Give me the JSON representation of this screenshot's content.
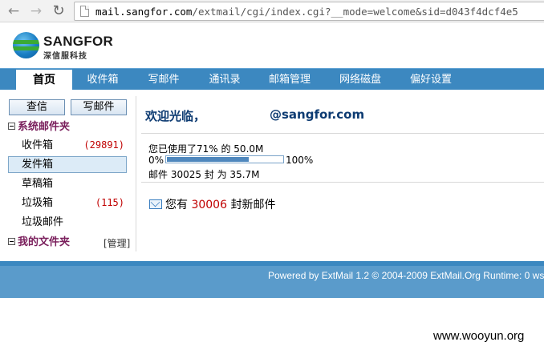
{
  "browser": {
    "url_host": "mail.sangfor.com",
    "url_path": "/extmail/cgi/index.cgi?__mode=welcome&sid=d043f4dcf4e5"
  },
  "logo": {
    "name": "SANGFOR",
    "subtitle": "深信服科技",
    "colors": {
      "globe": "#1b7fc4",
      "swoosh": "#3aaa35"
    }
  },
  "nav": {
    "tabs": [
      {
        "label": "首页",
        "active": true
      },
      {
        "label": "收件箱"
      },
      {
        "label": "写邮件"
      },
      {
        "label": "通讯录"
      },
      {
        "label": "邮箱管理"
      },
      {
        "label": "网络磁盘"
      },
      {
        "label": "偏好设置"
      }
    ]
  },
  "sidebar": {
    "inbox_button": "查信",
    "compose_button": "写邮件",
    "system_folders": {
      "title": "系统邮件夹",
      "items": [
        {
          "label": "收件箱",
          "count": "(29891)"
        },
        {
          "label": "发件箱",
          "count": "",
          "selected": true
        },
        {
          "label": "草稿箱",
          "count": ""
        },
        {
          "label": "垃圾箱",
          "count": "(115)"
        },
        {
          "label": "垃圾邮件",
          "count": ""
        }
      ]
    },
    "my_folders": {
      "title": "我的文件夹",
      "manage": "[管理]"
    }
  },
  "content": {
    "welcome": "欢迎光临，",
    "domain": "@sangfor.com",
    "quota_text": "您已使用了71% 的 50.0M",
    "quota_min": "0%",
    "quota_max": "100%",
    "quota_percent": 71,
    "mail_stats": "邮件 30025 封 为 35.7M",
    "new_mail_prefix": "您有",
    "new_mail_count": "30006",
    "new_mail_suffix": "封新邮件"
  },
  "footer": {
    "text": "Powered by ExtMail 1.2 © 2004-2009 ExtMail.Org Runtime: 0 ws"
  },
  "watermark": "www.wooyun.org",
  "colors": {
    "nav": "#3c88c0",
    "footer": "#5a9bcb",
    "accent_red": "#c00000",
    "welcome": "#0d3b72"
  }
}
